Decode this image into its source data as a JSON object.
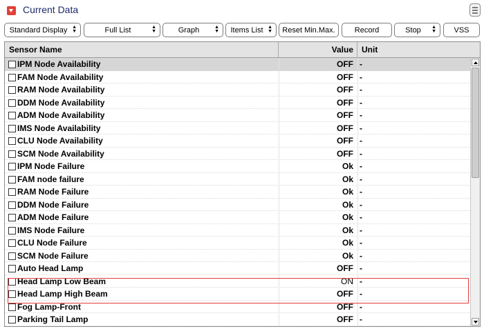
{
  "window": {
    "title": "Current Data",
    "icons": {
      "collapse": "chevron-down-icon",
      "menu": "menu-icon"
    },
    "accent_color": "#e0403a",
    "title_color": "#1c2b6b"
  },
  "toolbar": {
    "standard_display": "Standard Display",
    "full_list": "Full List",
    "graph": "Graph",
    "items_list": "Items List",
    "reset_min_max": "Reset Min.Max.",
    "record": "Record",
    "stop": "Stop",
    "vss": "VSS"
  },
  "table": {
    "headers": {
      "name": "Sensor Name",
      "value": "Value",
      "unit": "Unit"
    },
    "rows": [
      {
        "name": "IPM Node Availability",
        "value": "OFF",
        "unit": "-"
      },
      {
        "name": "FAM Node Availability",
        "value": "OFF",
        "unit": "-"
      },
      {
        "name": "RAM Node Availability",
        "value": "OFF",
        "unit": "-"
      },
      {
        "name": "DDM Node Availability",
        "value": "OFF",
        "unit": "-"
      },
      {
        "name": "ADM Node Availability",
        "value": "OFF",
        "unit": "-"
      },
      {
        "name": "IMS Node Availability",
        "value": "OFF",
        "unit": "-"
      },
      {
        "name": "CLU Node Availability",
        "value": "OFF",
        "unit": "-"
      },
      {
        "name": "SCM Node Availability",
        "value": "OFF",
        "unit": "-"
      },
      {
        "name": "IPM Node Failure",
        "value": "Ok",
        "unit": "-"
      },
      {
        "name": "FAM node failure",
        "value": "Ok",
        "unit": "-"
      },
      {
        "name": "RAM Node Failure",
        "value": "Ok",
        "unit": "-"
      },
      {
        "name": "DDM Node Failure",
        "value": "Ok",
        "unit": "-"
      },
      {
        "name": "ADM Node Failure",
        "value": "Ok",
        "unit": "-"
      },
      {
        "name": "IMS Node Failure",
        "value": "Ok",
        "unit": "-"
      },
      {
        "name": "CLU Node Failure",
        "value": "Ok",
        "unit": "-"
      },
      {
        "name": "SCM Node Failure",
        "value": "Ok",
        "unit": "-"
      },
      {
        "name": "Auto Head Lamp",
        "value": "OFF",
        "unit": "-"
      },
      {
        "name": "Head Lamp Low Beam",
        "value": "ON",
        "unit": "-"
      },
      {
        "name": "Head Lamp High Beam",
        "value": "OFF",
        "unit": "-"
      },
      {
        "name": "Fog Lamp-Front",
        "value": "OFF",
        "unit": "-"
      },
      {
        "name": "Parking Tail Lamp",
        "value": "OFF",
        "unit": "-"
      }
    ]
  }
}
